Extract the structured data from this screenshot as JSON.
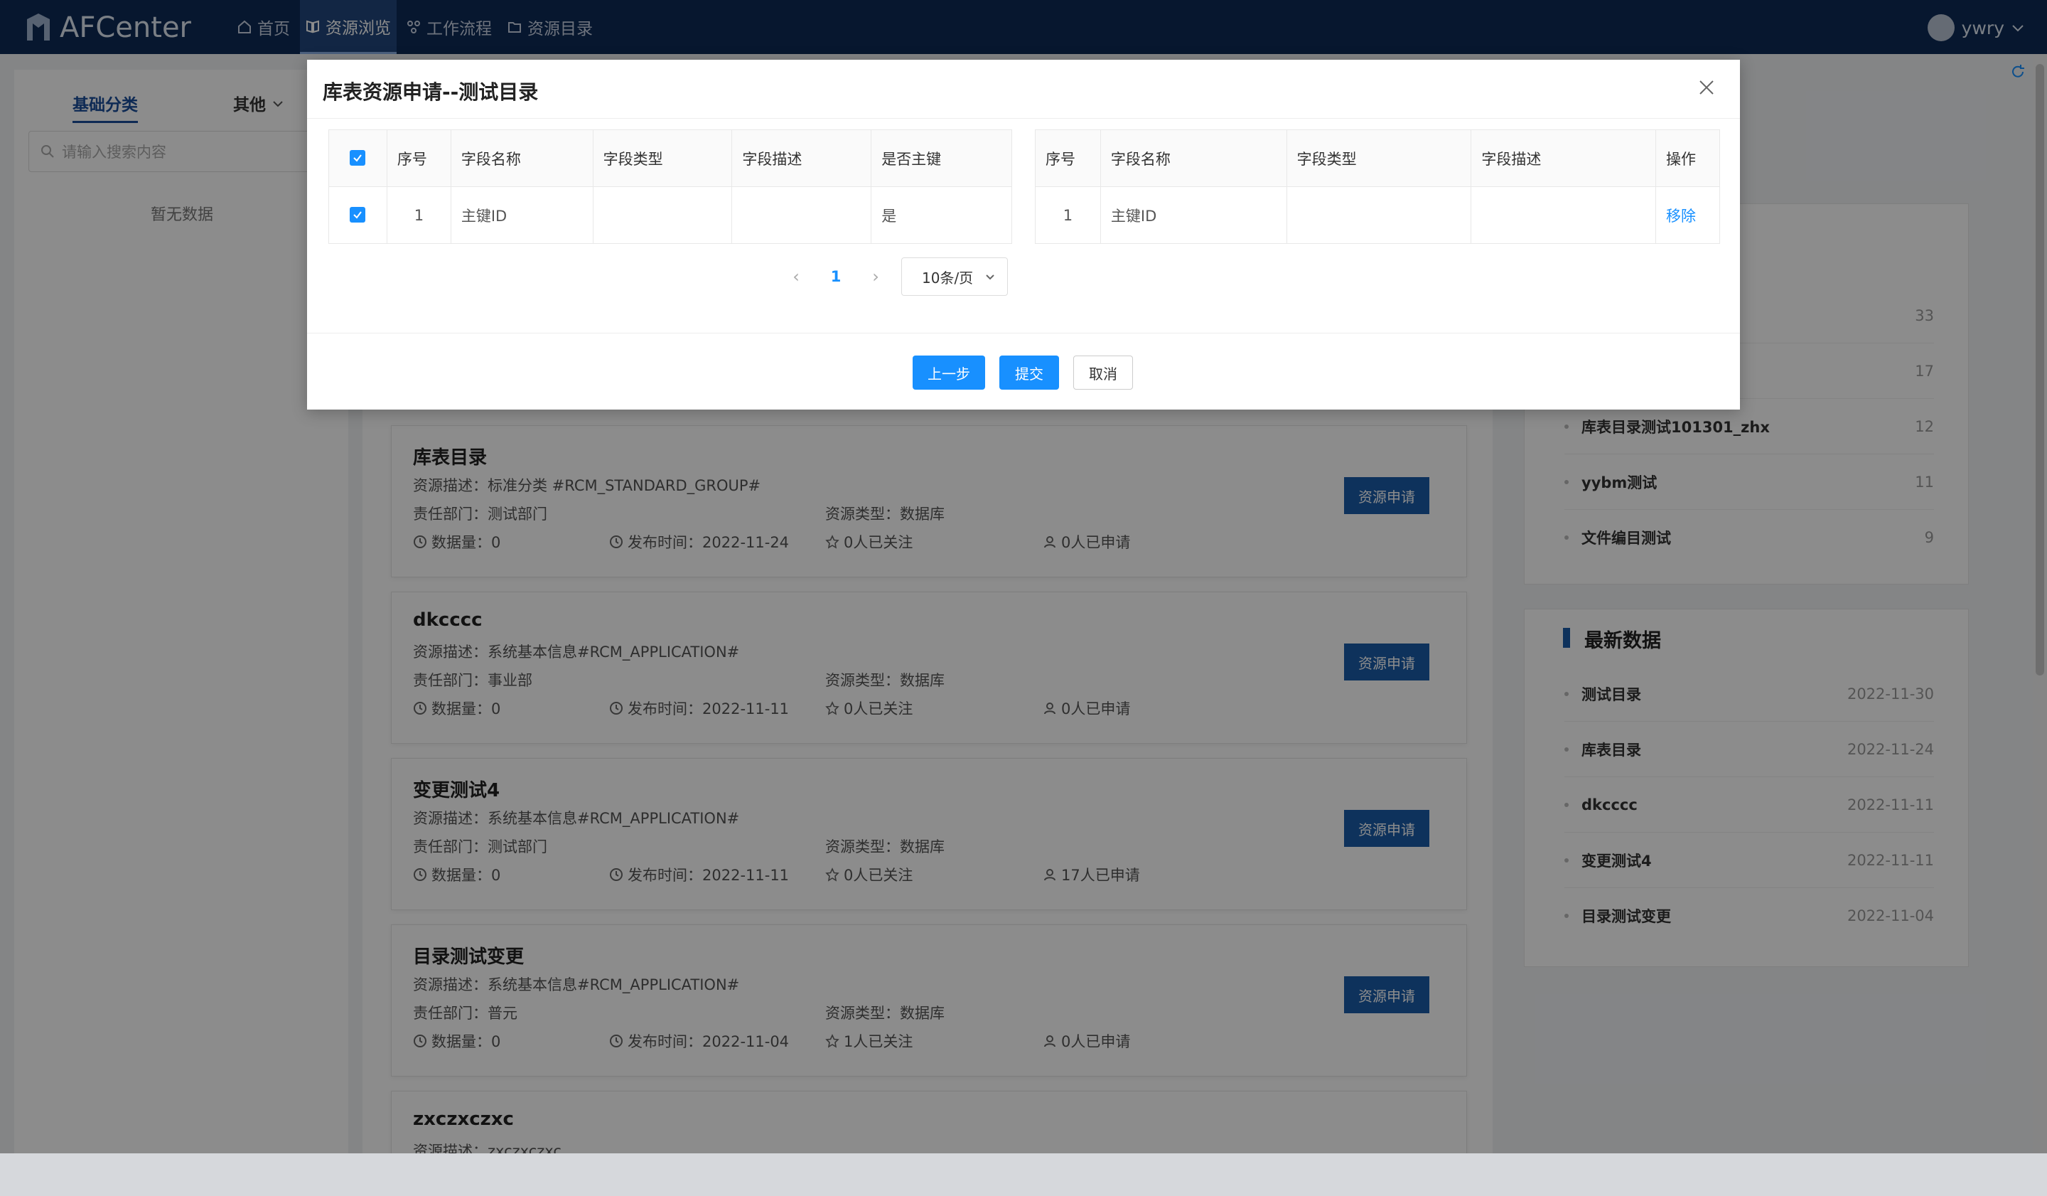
{
  "app": {
    "name": "AFCenter"
  },
  "nav": [
    {
      "label": "首页",
      "icon": "home-icon"
    },
    {
      "label": "资源浏览",
      "icon": "book-icon",
      "active": true
    },
    {
      "label": "工作流程",
      "icon": "workflow-icon"
    },
    {
      "label": "资源目录",
      "icon": "folder-icon"
    }
  ],
  "user": {
    "name": "ywry"
  },
  "left": {
    "tabs": [
      "基础分类",
      "其他"
    ],
    "search_placeholder": "请输入搜索内容",
    "empty": "暂无数据"
  },
  "cards": [
    {
      "title": "库表目录",
      "desc": "资源描述：标准分类 #RCM_STANDARD_GROUP#",
      "dept": "责任部门：测试部门",
      "type": "资源类型：数据库",
      "count": "数据量：0",
      "date": "发布时间：2022-11-24",
      "follow": "0人已关注",
      "applied": "0人已申请",
      "button": "资源申请"
    },
    {
      "title": "dkcccc",
      "desc": "资源描述：系统基本信息#RCM_APPLICATION#",
      "dept": "责任部门：事业部",
      "type": "资源类型：数据库",
      "count": "数据量：0",
      "date": "发布时间：2022-11-11",
      "follow": "0人已关注",
      "applied": "0人已申请",
      "button": "资源申请"
    },
    {
      "title": "变更测试4",
      "desc": "资源描述：系统基本信息#RCM_APPLICATION#",
      "dept": "责任部门：测试部门",
      "type": "资源类型：数据库",
      "count": "数据量：0",
      "date": "发布时间：2022-11-11",
      "follow": "0人已关注",
      "applied": "17人已申请",
      "button": "资源申请"
    },
    {
      "title": "目录测试变更",
      "desc": "资源描述：系统基本信息#RCM_APPLICATION#",
      "dept": "责任部门：普元",
      "type": "资源类型：数据库",
      "count": "数据量：0",
      "date": "发布时间：2022-11-04",
      "follow": "1人已关注",
      "applied": "0人已申请",
      "button": "资源申请"
    },
    {
      "title": "zxczxczxc",
      "desc": "资源描述：zxczxczxc"
    }
  ],
  "hot": [
    {
      "name": "",
      "value": "33"
    },
    {
      "name": "",
      "value": "17"
    },
    {
      "name": "库表目录测试101301_zhx",
      "value": "12"
    },
    {
      "name": "yybm测试",
      "value": "11"
    },
    {
      "name": "文件编目测试",
      "value": "9"
    }
  ],
  "latest": {
    "title": "最新数据",
    "items": [
      {
        "name": "测试目录",
        "date": "2022-11-30"
      },
      {
        "name": "库表目录",
        "date": "2022-11-24"
      },
      {
        "name": "dkcccc",
        "date": "2022-11-11"
      },
      {
        "name": "变更测试4",
        "date": "2022-11-11"
      },
      {
        "name": "目录测试变更",
        "date": "2022-11-04"
      }
    ]
  },
  "modal": {
    "title": "库表资源申请--测试目录",
    "left_table": {
      "headers": [
        "序号",
        "字段名称",
        "字段类型",
        "字段描述",
        "是否主键"
      ],
      "rows": [
        {
          "index": "1",
          "name": "主键ID",
          "type": "",
          "desc": "",
          "pk": "是",
          "checked": true
        }
      ]
    },
    "right_table": {
      "headers": [
        "序号",
        "字段名称",
        "字段类型",
        "字段描述",
        "操作"
      ],
      "rows": [
        {
          "index": "1",
          "name": "主键ID",
          "type": "",
          "desc": "",
          "action": "移除"
        }
      ]
    },
    "pagination": {
      "current": "1",
      "page_size": "10条/页"
    },
    "buttons": {
      "prev": "上一步",
      "submit": "提交",
      "cancel": "取消"
    }
  }
}
